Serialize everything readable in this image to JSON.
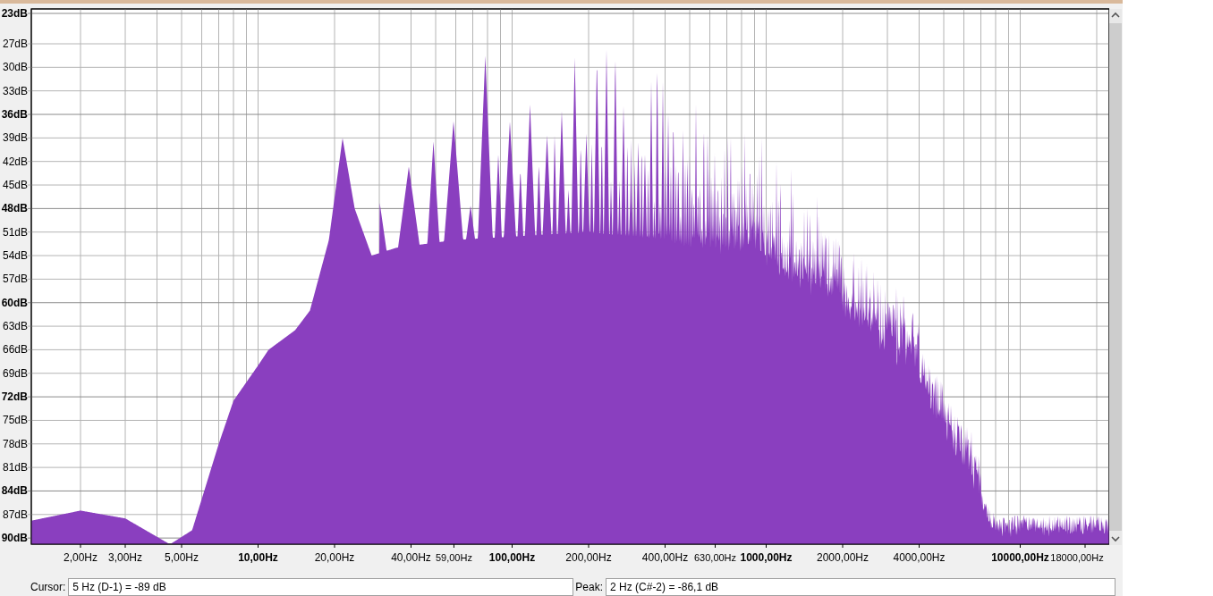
{
  "plot": {
    "y_ticks": [
      {
        "label": "23dB",
        "major": true
      },
      {
        "label": "27dB",
        "major": false
      },
      {
        "label": "30dB",
        "major": false
      },
      {
        "label": "33dB",
        "major": false
      },
      {
        "label": "36dB",
        "major": true
      },
      {
        "label": "39dB",
        "major": false
      },
      {
        "label": "42dB",
        "major": false
      },
      {
        "label": "45dB",
        "major": false
      },
      {
        "label": "48dB",
        "major": true
      },
      {
        "label": "51dB",
        "major": false
      },
      {
        "label": "54dB",
        "major": false
      },
      {
        "label": "57dB",
        "major": false
      },
      {
        "label": "60dB",
        "major": true
      },
      {
        "label": "63dB",
        "major": false
      },
      {
        "label": "66dB",
        "major": false
      },
      {
        "label": "69dB",
        "major": false
      },
      {
        "label": "72dB",
        "major": true
      },
      {
        "label": "75dB",
        "major": false
      },
      {
        "label": "78dB",
        "major": false
      },
      {
        "label": "81dB",
        "major": false
      },
      {
        "label": "84dB",
        "major": true
      },
      {
        "label": "87dB",
        "major": false
      },
      {
        "label": "90dB",
        "major": true
      }
    ],
    "x_ticks": [
      {
        "label": "2,00Hz",
        "kind": "normal"
      },
      {
        "label": "3,00Hz",
        "kind": "normal"
      },
      {
        "label": "5,00Hz",
        "kind": "normal"
      },
      {
        "label": "10,00Hz",
        "kind": "major"
      },
      {
        "label": "20,00Hz",
        "kind": "normal"
      },
      {
        "label": "40,00Hz",
        "kind": "normal"
      },
      {
        "label": "59,00Hz",
        "kind": "small"
      },
      {
        "label": "100,00Hz",
        "kind": "major"
      },
      {
        "label": "200,00Hz",
        "kind": "normal"
      },
      {
        "label": "400,00Hz",
        "kind": "normal"
      },
      {
        "label": "630,00Hz",
        "kind": "small"
      },
      {
        "label": "1000,00Hz",
        "kind": "major"
      },
      {
        "label": "2000,00Hz",
        "kind": "normal"
      },
      {
        "label": "4000,00Hz",
        "kind": "normal"
      },
      {
        "label": "10000,00Hz",
        "kind": "major"
      },
      {
        "label": "18000,00Hz",
        "kind": "small"
      }
    ]
  },
  "cursor": {
    "label": "Cursor:",
    "value": "5 Hz (D-1) = -89 dB"
  },
  "peak": {
    "label": "Peak:",
    "value": "2 Hz (C#-2) = -86,1 dB"
  }
}
